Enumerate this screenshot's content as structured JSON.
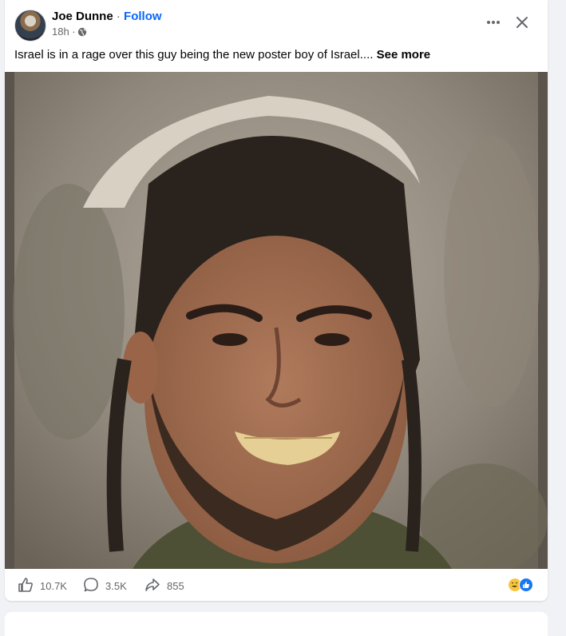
{
  "post": {
    "author": "Joe Dunne",
    "separator": "·",
    "follow_label": "Follow",
    "timestamp": "18h ·",
    "text": "Israel is in a rage over this guy being the new poster boy of Israel....",
    "see_more_label": "See more"
  },
  "actions": {
    "like_count": "10.7K",
    "comment_count": "3.5K",
    "share_count": "855"
  },
  "icons": {
    "privacy": "globe-icon",
    "more": "more-options-icon",
    "close": "close-icon",
    "like": "thumbs-up-icon",
    "comment": "comment-bubble-icon",
    "share": "share-arrow-icon",
    "reactions": [
      "laughing-emoji-icon",
      "like-reaction-icon"
    ]
  },
  "colors": {
    "link": "#0866ff",
    "like_reaction": "#1877f2",
    "background": "#f0f2f5"
  }
}
